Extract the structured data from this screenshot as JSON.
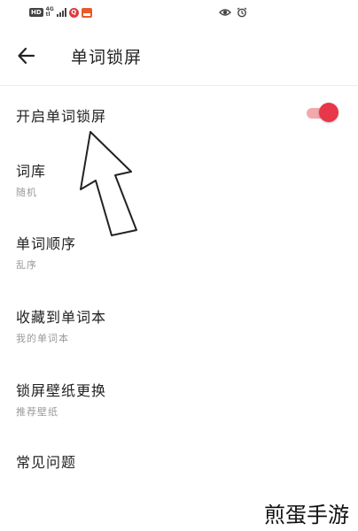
{
  "status_bar": {
    "hd": "HD",
    "net_top": "4G",
    "net_bottom": "tl",
    "app_badge": "Q",
    "right_icons": [
      "eye-icon",
      "alarm-icon"
    ]
  },
  "header": {
    "back_icon": "arrow-left-icon",
    "title": "单词锁屏"
  },
  "settings": {
    "items": [
      {
        "title": "开启单词锁屏",
        "subtitle": "",
        "toggle": true
      },
      {
        "title": "词库",
        "subtitle": "随机"
      },
      {
        "title": "单词顺序",
        "subtitle": "乱序"
      },
      {
        "title": "收藏到单词本",
        "subtitle": "我的单词本"
      },
      {
        "title": "锁屏壁纸更换",
        "subtitle": "推荐壁纸"
      },
      {
        "title": "常见问题",
        "subtitle": ""
      }
    ]
  },
  "colors": {
    "toggle_on": "#e8364a",
    "toggle_track": "#f3a9ac",
    "subtitle": "#9a9a9a"
  },
  "watermark": "煎蛋手游"
}
